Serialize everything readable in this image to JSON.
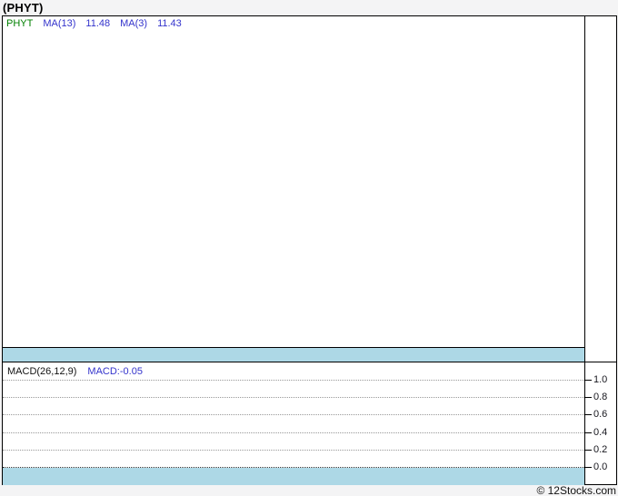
{
  "window": {
    "title": "(PHYT)",
    "footer_credit": "© 12Stocks.com"
  },
  "price_panel": {
    "legend": {
      "symbol": "PHYT",
      "ma1_label": "MA(13)",
      "ma1_value": "11.48",
      "ma2_label": "MA(3)",
      "ma2_value": "11.43"
    }
  },
  "macd_panel": {
    "legend_label": "MACD(26,12,9)",
    "legend_value": "MACD:-0.05",
    "yticks": [
      "1.0",
      "0.8",
      "0.6",
      "0.4",
      "0.2",
      "0.0"
    ]
  },
  "colors": {
    "symbol_green": "#008000",
    "ma_blue": "#3333cc",
    "separator_band_cyan": "#add8e6",
    "gridline_gray": "#999999",
    "zero_line_dark": "#333333",
    "page_background": "#f4f4f5",
    "panel_background": "#ffffff",
    "border_black": "#000000"
  },
  "chart_data": [
    {
      "type": "line",
      "panel": "price",
      "title": "(PHYT)",
      "series": [
        {
          "name": "PHYT",
          "values": []
        },
        {
          "name": "MA(13)",
          "last_value": 11.48,
          "values": []
        },
        {
          "name": "MA(3)",
          "last_value": 11.43,
          "values": []
        }
      ],
      "x": [],
      "grid": false,
      "legend_position": "top-left",
      "notes": "no plotted data points visible in panel"
    },
    {
      "type": "line",
      "panel": "indicator",
      "title": "MACD(26,12,9)",
      "series": [
        {
          "name": "MACD",
          "last_value": -0.05,
          "values": []
        }
      ],
      "x": [],
      "yticks": [
        1.0,
        0.8,
        0.6,
        0.4,
        0.2,
        0.0
      ],
      "ylim": [
        0.0,
        1.0
      ],
      "grid": true,
      "legend_position": "top-left",
      "notes": "no plotted data points visible in panel"
    }
  ]
}
